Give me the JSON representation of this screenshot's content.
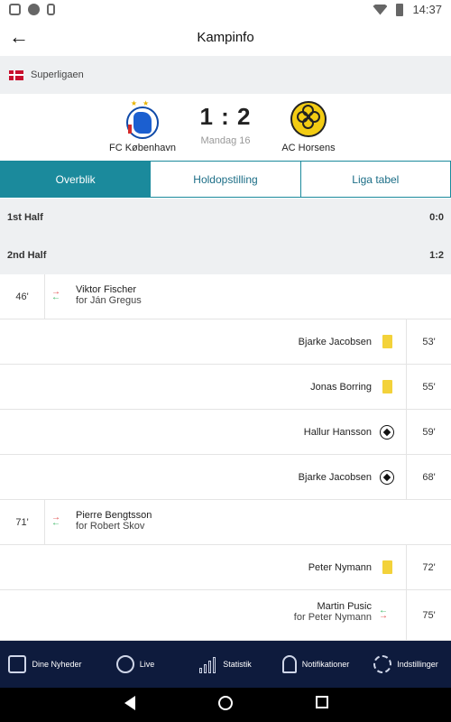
{
  "status_bar": {
    "time": "14:37"
  },
  "app_bar": {
    "title": "Kampinfo"
  },
  "league": {
    "name": "Superligaen"
  },
  "match": {
    "home_team": "FC København",
    "away_team": "AC Horsens",
    "score": "1 : 2",
    "date": "Mandag 16"
  },
  "tabs": [
    {
      "label": "Overblik",
      "active": true
    },
    {
      "label": "Holdopstilling",
      "active": false
    },
    {
      "label": "Liga tabel",
      "active": false
    }
  ],
  "halves": [
    {
      "label": "1st Half",
      "score": "0:0"
    },
    {
      "label": "2nd Half",
      "score": "1:2"
    }
  ],
  "events": [
    {
      "side": "home",
      "minute": "46'",
      "type": "substitution",
      "player": "Viktor Fischer",
      "sub_text": "for Ján Gregus"
    },
    {
      "side": "away",
      "minute": "53'",
      "type": "yellow-card",
      "player": "Bjarke Jacobsen",
      "sub_text": ""
    },
    {
      "side": "away",
      "minute": "55'",
      "type": "yellow-card",
      "player": "Jonas Borring",
      "sub_text": ""
    },
    {
      "side": "away",
      "minute": "59'",
      "type": "goal",
      "player": "Hallur Hansson",
      "sub_text": ""
    },
    {
      "side": "away",
      "minute": "68'",
      "type": "goal",
      "player": "Bjarke Jacobsen",
      "sub_text": ""
    },
    {
      "side": "home",
      "minute": "71'",
      "type": "substitution",
      "player": "Pierre Bengtsson",
      "sub_text": "for Robert Skov"
    },
    {
      "side": "away",
      "minute": "72'",
      "type": "yellow-card",
      "player": "Peter Nymann",
      "sub_text": ""
    },
    {
      "side": "away",
      "minute": "75'",
      "type": "substitution",
      "player": "Martin Pusic",
      "sub_text": "for Peter Nymann"
    }
  ],
  "bottom_nav": [
    {
      "label": "Dine Nyheder",
      "icon": "news-icon"
    },
    {
      "label": "Live",
      "icon": "stopwatch-icon"
    },
    {
      "label": "Statistik",
      "icon": "bar-chart-icon"
    },
    {
      "label": "Notifikationer",
      "icon": "bell-icon"
    },
    {
      "label": "Indstillinger",
      "icon": "gear-icon"
    }
  ],
  "colors": {
    "accent": "#1b8a9c",
    "nav_bg": "#0e1b3d",
    "section_bg": "#eef0f2",
    "yellow_card": "#f3d23a"
  }
}
